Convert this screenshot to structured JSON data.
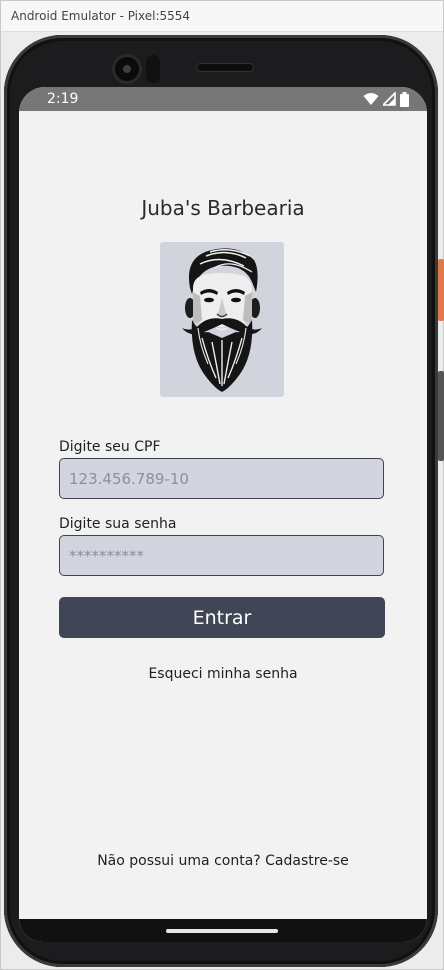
{
  "window": {
    "title": "Android Emulator - Pixel:5554"
  },
  "status_bar": {
    "time": "2:19",
    "icons": [
      "wifi-icon",
      "cell-signal-icon",
      "battery-icon"
    ]
  },
  "app": {
    "title": "Juba's Barbearia",
    "logo": "bearded-man-logo"
  },
  "form": {
    "cpf_label": "Digite seu CPF",
    "cpf_placeholder": "123.456.789-10",
    "password_label": "Digite sua senha",
    "password_placeholder": "**********",
    "submit_label": "Entrar",
    "forgot_password": "Esqueci minha senha",
    "signup_prompt": "Não possui uma conta? Cadastre-se"
  },
  "colors": {
    "accent_button": "#404656",
    "input_background": "#d2d4de",
    "screen_background": "#f2f2f2",
    "status_bar": "#777777"
  }
}
